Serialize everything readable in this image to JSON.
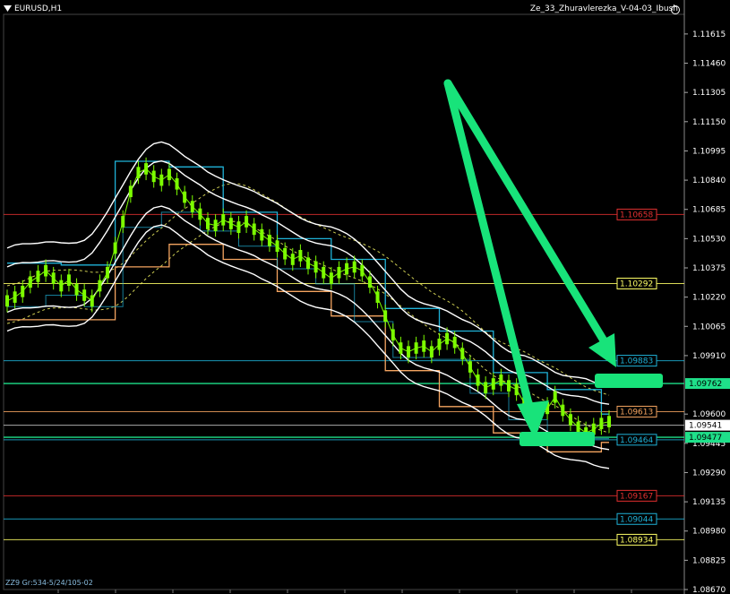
{
  "window": {
    "symbol_title": "EURUSD,H1",
    "indicator_title": "Ze_33_Zhuravlerezka_V-04-03_Ibush",
    "footer_label": "ZZ9 Gr:534-5/24/105-02"
  },
  "colors": {
    "background": "#000000",
    "candles": "#7CFC00",
    "cyan_steps": "#1fb2d8",
    "orange_steps": "#f4a460",
    "white_bands": "#ffffff",
    "dashed_ma": "#ffff66",
    "arrow": "#18e37a",
    "red_level": "#e23030",
    "yellow_level": "#ffff66",
    "cyan_level": "#1fb2d8",
    "white_level": "#c8c8c8",
    "green_level": "#1fe08a"
  },
  "chart_data": {
    "type": "line",
    "symbol": "EURUSD",
    "timeframe": "H1",
    "ylim": [
      1.0867,
      1.117
    ],
    "y_ticks": [
      "1.11615",
      "1.11460",
      "1.11305",
      "1.11150",
      "1.10995",
      "1.10840",
      "1.10685",
      "1.10530",
      "1.10375",
      "1.10220",
      "1.10065",
      "1.09910",
      "1.09600",
      "1.09445",
      "1.09290",
      "1.09135",
      "1.08980",
      "1.08825",
      "1.08670"
    ],
    "levels": [
      {
        "label": "1.10658",
        "color": "red",
        "tagged": true
      },
      {
        "label": "1.10292",
        "color": "yellow",
        "tagged": true
      },
      {
        "label": "1.09883",
        "color": "cyan",
        "tagged": true
      },
      {
        "label": "1.09762",
        "color": "green",
        "tagged": true,
        "right_tag": true
      },
      {
        "label": "1.09613",
        "color": "orange",
        "tagged": true
      },
      {
        "label": "1.09541",
        "color": "white",
        "tagged": true,
        "right_tag": true
      },
      {
        "label": "1.09477",
        "color": "green",
        "tagged": true,
        "right_tag": true
      },
      {
        "label": "1.09464",
        "color": "cyan",
        "tagged": true
      },
      {
        "label": "1.09167",
        "color": "red",
        "tagged": true
      },
      {
        "label": "1.09044",
        "color": "cyan",
        "tagged": true
      },
      {
        "label": "1.08934",
        "color": "yellow",
        "tagged": true
      }
    ],
    "series": [
      {
        "values": [
          1.102,
          1.1022,
          1.1025,
          1.103,
          1.1033,
          1.1036,
          1.1032,
          1.1028,
          1.1031,
          1.1026,
          1.1023,
          1.102,
          1.1028,
          1.1035,
          1.1048,
          1.1062,
          1.1078,
          1.1088,
          1.109,
          1.1086,
          1.1084,
          1.1087,
          1.1082,
          1.1075,
          1.107,
          1.1066,
          1.1061,
          1.106,
          1.1063,
          1.1061,
          1.1059,
          1.1062,
          1.1058,
          1.1055,
          1.1052,
          1.1049,
          1.1045,
          1.1042,
          1.1044,
          1.104,
          1.1038,
          1.1035,
          1.1032,
          1.1035,
          1.1037,
          1.1038,
          1.1036,
          1.103,
          1.1022,
          1.1012,
          1.1002,
          1.0995,
          1.0993,
          1.0995,
          1.0996,
          1.0993,
          1.0997,
          1.1,
          1.0998,
          1.0992,
          1.0985,
          1.0978,
          1.0974,
          1.0976,
          1.0978,
          1.0975,
          1.0973,
          1.0966,
          1.0961,
          1.096,
          1.0963,
          1.0969,
          1.0962,
          1.0957,
          1.0953,
          1.095,
          1.0952,
          1.0955,
          1.0956
        ]
      }
    ]
  }
}
